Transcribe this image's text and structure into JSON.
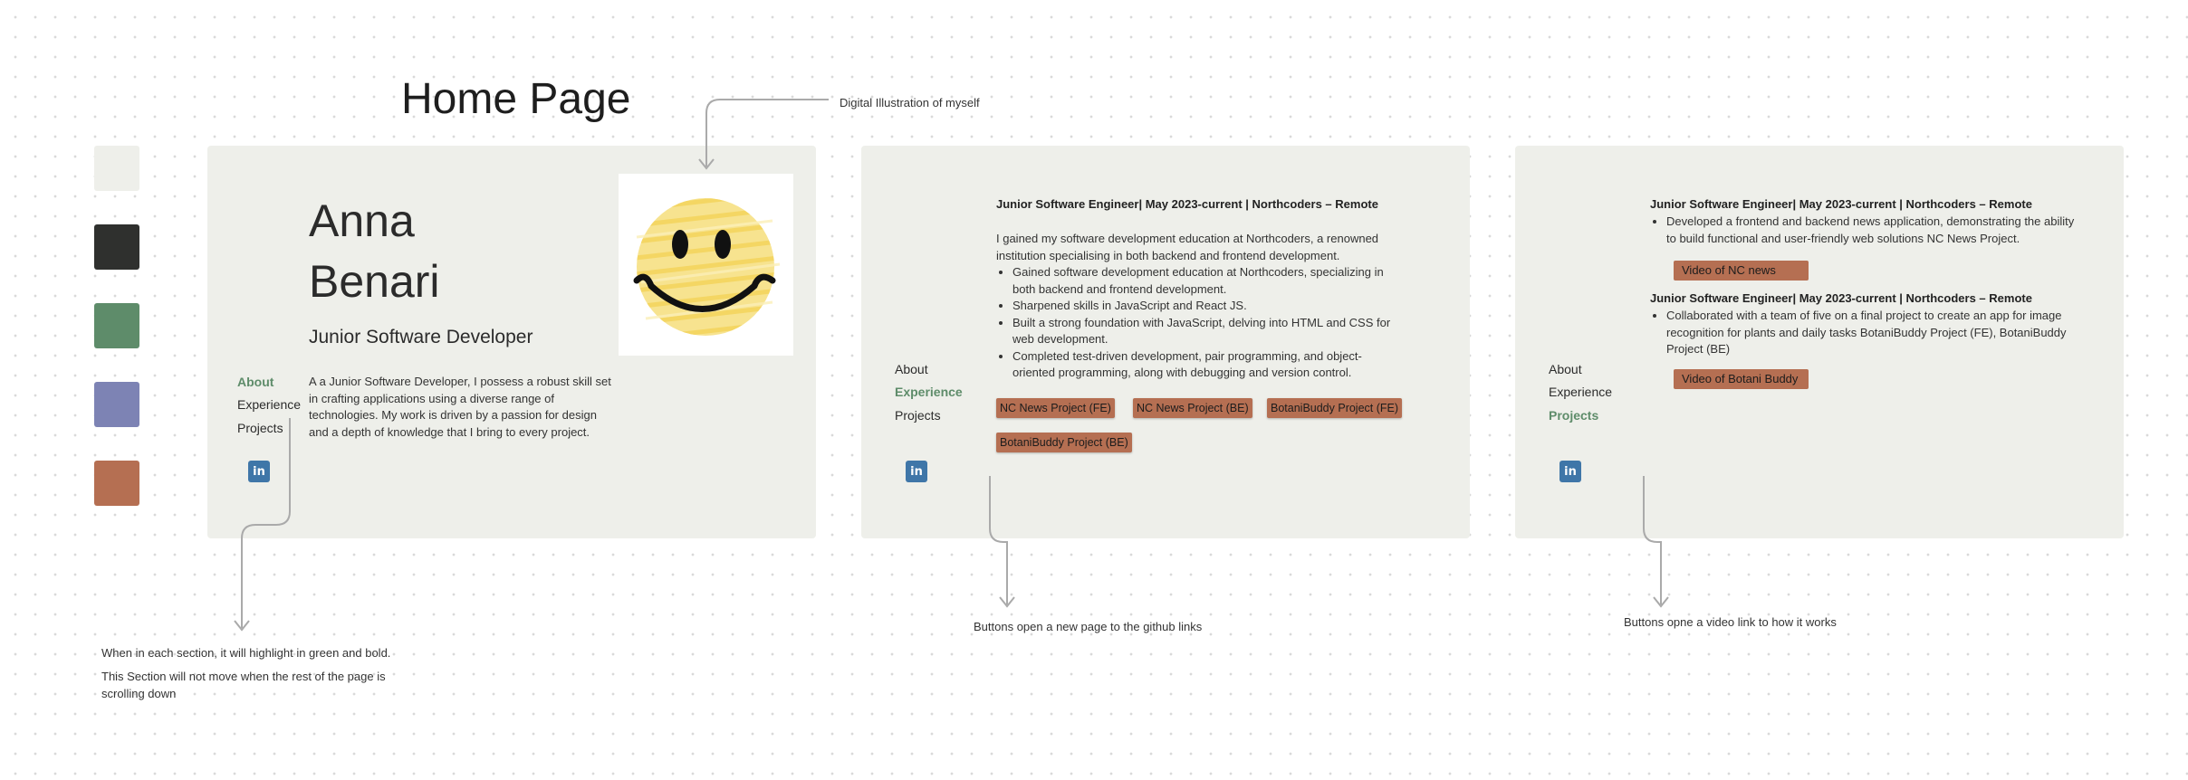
{
  "page_title": "Home Page",
  "annotations": {
    "illustration": "Digital Illustration of myself",
    "nav_highlight": "When in each section, it will highlight in green and bold.",
    "nav_fixed": "This Section will not move when the rest of the page is scrolling down",
    "github_buttons": "Buttons open a new page to the github links",
    "video_buttons": "Buttons opne a video link to how it works"
  },
  "palette": [
    "#eeefea",
    "#2f302e",
    "#5e8c6a",
    "#7d83b4",
    "#b56f52"
  ],
  "nav": {
    "about": "About",
    "experience": "Experience",
    "projects": "Projects",
    "linkedin_icon": "linkedin-icon"
  },
  "about_section": {
    "first_name": "Anna",
    "last_name": "Benari",
    "role": "Junior Software Developer",
    "bio": "A a Junior Software Developer, I possess a robust skill set in crafting applications using a diverse range of technologies. My work is driven by a passion for design and a depth of knowledge that I bring to every project."
  },
  "experience_section": {
    "job_title": "Junior Software Engineer| May 2023-current | Northcoders – Remote",
    "intro": "I gained my software development education at Northcoders, a renowned institution specialising in both backend and frontend development.",
    "bullets": [
      "Gained software development education at Northcoders, specializing in both backend and frontend development.",
      "Sharpened skills in JavaScript and React JS.",
      "Built a strong foundation with JavaScript, delving into HTML and CSS for web development.",
      "Completed test-driven development, pair programming, and object-oriented programming, along with debugging and version control."
    ],
    "links": [
      "NC News Project (FE)",
      "NC News Project (BE)",
      "BotaniBuddy Project (FE)",
      "BotaniBuddy Project (BE)"
    ]
  },
  "projects_section": {
    "project1": {
      "title": "Junior Software Engineer| May 2023-current | Northcoders – Remote",
      "bullet": "Developed a frontend and backend news application, demonstrating the ability to build functional and user-friendly web solutions NC News Project.",
      "video": "Video of NC news"
    },
    "project2": {
      "title": "Junior Software Engineer| May 2023-current | Northcoders – Remote",
      "bullet": "Collaborated with a team of five on a final project to create an app for image recognition for plants and daily tasks BotaniBuddy Project (FE), BotaniBuddy Project (BE)",
      "video": "Video of Botani Buddy"
    }
  }
}
